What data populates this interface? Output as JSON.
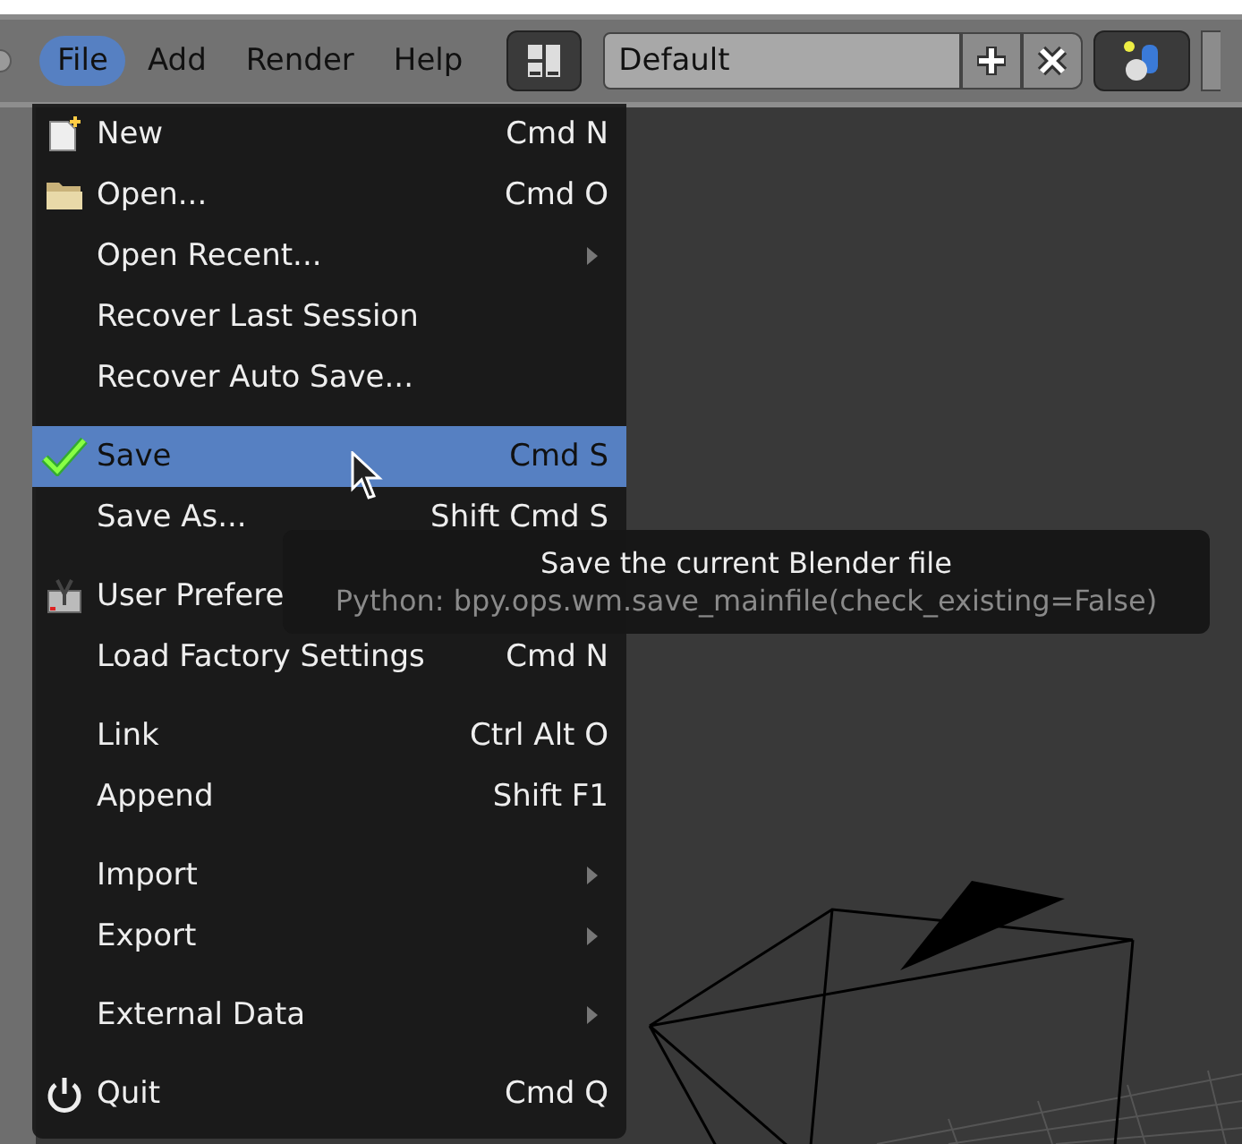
{
  "menubar": {
    "menus": [
      {
        "label": "File",
        "selected": true
      },
      {
        "label": "Add",
        "selected": false
      },
      {
        "label": "Render",
        "selected": false
      },
      {
        "label": "Help",
        "selected": false
      }
    ]
  },
  "screen_layout": {
    "value": "Default"
  },
  "file_menu": {
    "sections": [
      [
        {
          "label": "New",
          "shortcut": "Cmd N",
          "submenu": false,
          "highlighted": false
        },
        {
          "label": "Open...",
          "shortcut": "Cmd O",
          "submenu": false,
          "highlighted": false
        },
        {
          "label": "Open Recent...",
          "submenu": true,
          "highlighted": false
        },
        {
          "label": "Recover Last Session",
          "submenu": false,
          "highlighted": false
        },
        {
          "label": "Recover Auto Save...",
          "submenu": false,
          "highlighted": false
        }
      ],
      [
        {
          "label": "Save",
          "shortcut": "Cmd S",
          "submenu": false,
          "highlighted": true
        },
        {
          "label": "Save As...",
          "shortcut": "Shift Cmd S",
          "submenu": false,
          "highlighted": false
        }
      ],
      [
        {
          "label": "User Prefere",
          "submenu": false,
          "highlighted": false
        },
        {
          "label": "Load Factory Settings",
          "shortcut": "Cmd N",
          "submenu": false,
          "highlighted": false
        }
      ],
      [
        {
          "label": "Link",
          "shortcut": "Ctrl Alt O",
          "submenu": false,
          "highlighted": false
        },
        {
          "label": "Append",
          "shortcut": "Shift F1",
          "submenu": false,
          "highlighted": false
        }
      ],
      [
        {
          "label": "Import",
          "submenu": true,
          "highlighted": false
        },
        {
          "label": "Export",
          "submenu": true,
          "highlighted": false
        }
      ],
      [
        {
          "label": "External Data",
          "submenu": true,
          "highlighted": false
        }
      ],
      [
        {
          "label": "Quit",
          "shortcut": "Cmd Q",
          "submenu": false,
          "highlighted": false
        }
      ]
    ]
  },
  "tooltip": {
    "title": "Save the current Blender file",
    "python": "Python: bpy.ops.wm.save_mainfile(check_existing=False)"
  }
}
